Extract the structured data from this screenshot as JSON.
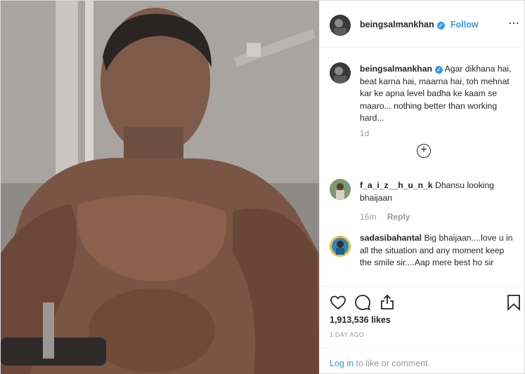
{
  "post": {
    "image_alt": "",
    "header": {
      "username": "beingsalmankhan",
      "follow_label": "Follow",
      "dot": "•",
      "more_icon": "⋯"
    },
    "caption": {
      "username": "beingsalmankhan",
      "text": "Agar dikhana hai, beat karna hai, maarna hai, toh mehnat kar ke apna level badha ke kaam se maaro... nothing better than working hard...",
      "time": "1d"
    },
    "load_more_icon": "+",
    "comments": [
      {
        "username": "f_a_i_z__h_u_n_k",
        "text": "Dhansu looking bhaijaan",
        "time": "16m",
        "reply_label": "Reply"
      },
      {
        "username": "sadasibahantal",
        "text": "Big bhaijaan....love u in all the situation and any moment keep the smile sir....Aap mere best ho sir"
      }
    ],
    "likes": "1,913,536 likes",
    "age": "1 DAY AGO",
    "login": {
      "link": "Log in",
      "rest": " to like or comment."
    },
    "colors": {
      "accent": "#3897f0",
      "text": "#262626",
      "muted": "#999999",
      "border": "#efefef"
    },
    "icons": [
      "heart-icon",
      "comment-icon",
      "share-icon",
      "bookmark-icon",
      "verified-icon",
      "plus-circle-icon",
      "more-options-icon"
    ]
  }
}
